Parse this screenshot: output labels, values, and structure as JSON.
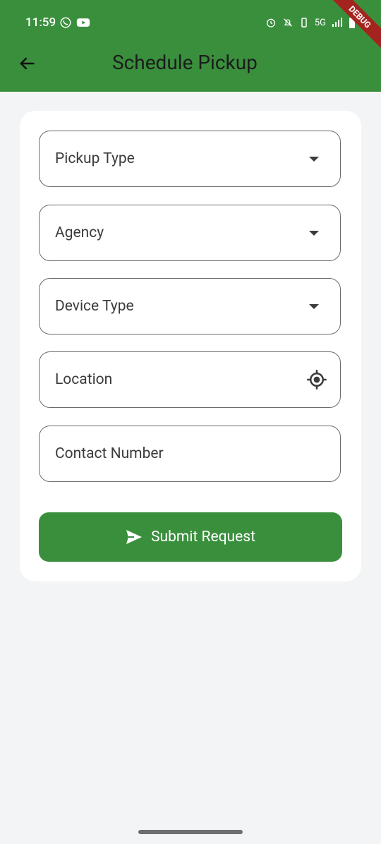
{
  "status_bar": {
    "time": "11:59",
    "network": "5G",
    "debug_label": "DEBUG"
  },
  "appbar": {
    "title": "Schedule Pickup"
  },
  "form": {
    "fields": [
      {
        "label": "Pickup Type"
      },
      {
        "label": "Agency"
      },
      {
        "label": "Device Type"
      },
      {
        "label": "Location"
      },
      {
        "label": "Contact Number"
      }
    ],
    "submit_label": "Submit Request"
  },
  "colors": {
    "primary": "#3a8f3d",
    "background": "#f3f4f6"
  }
}
